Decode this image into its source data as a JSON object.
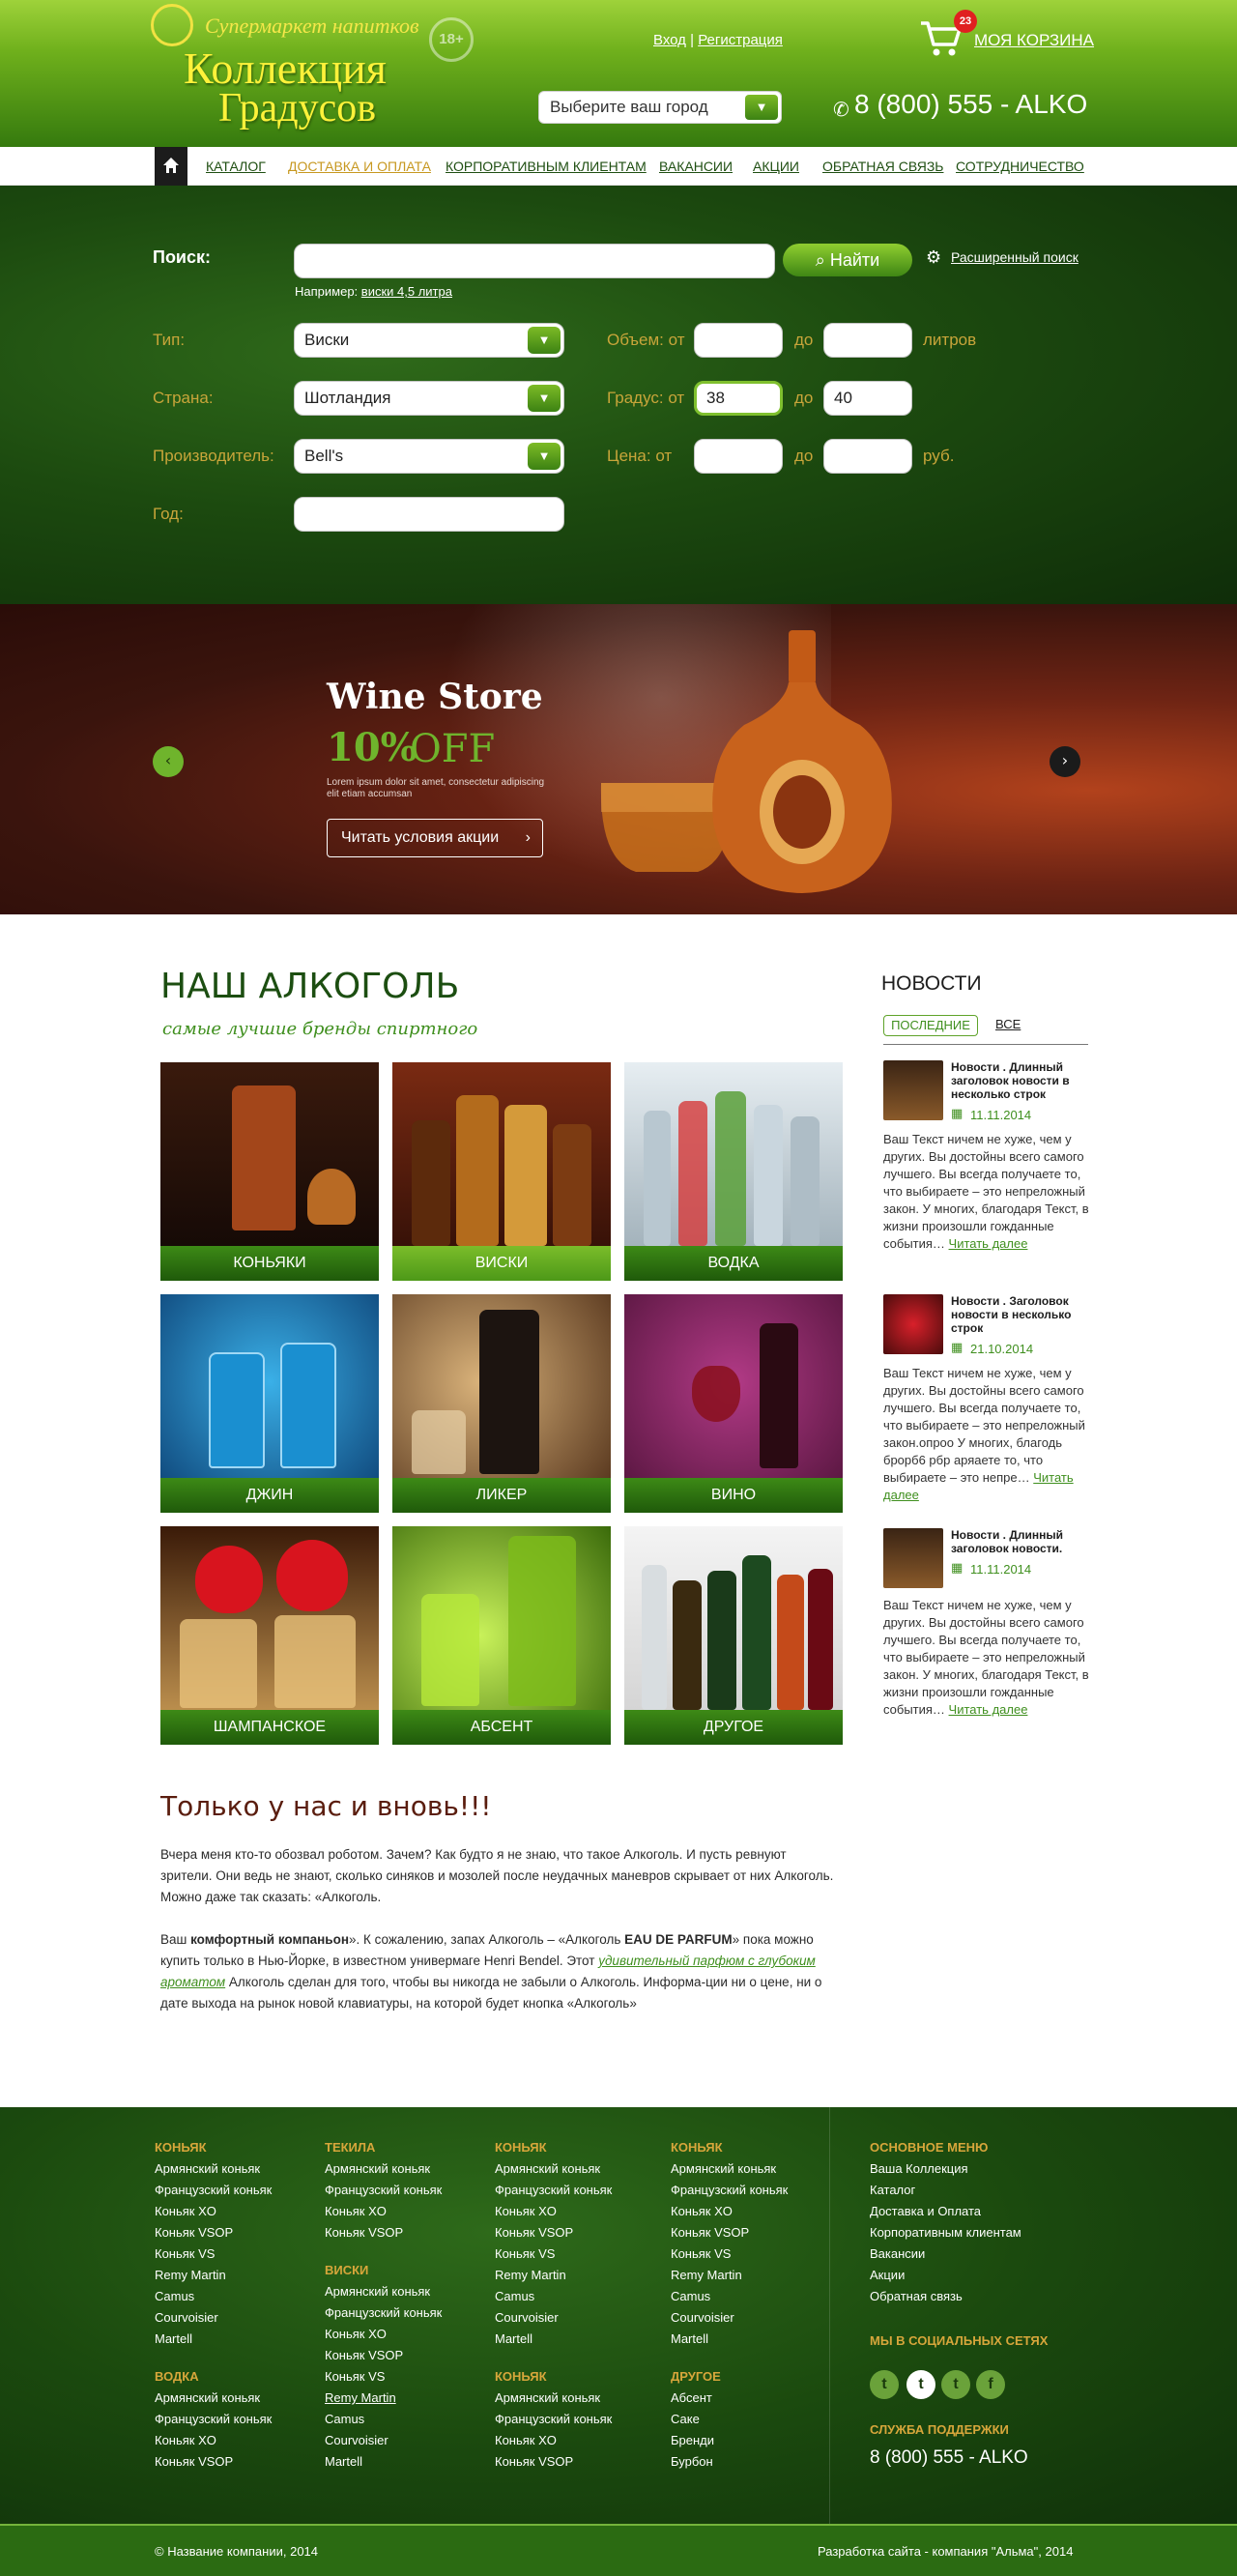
{
  "header": {
    "logo_tagline": "Супермаркет напитков",
    "logo_line1": "Коллекция",
    "logo_line2": "Градусов",
    "age_badge": "18+",
    "login": "Вход",
    "separator": "|",
    "register": "Регистрация",
    "cart_count": "23",
    "cart_label": "МОЯ КОРЗИНА",
    "city_select": "Выберите ваш город",
    "phone": "8 (800) 555 - ALKO"
  },
  "nav": {
    "items": [
      {
        "label": "КАТАЛОГ"
      },
      {
        "label": "ДОСТАВКА И ОПЛАТА",
        "active": true
      },
      {
        "label": "КОРПОРАТИВНЫМ КЛИЕНТАМ"
      },
      {
        "label": "ВАКАНСИИ"
      },
      {
        "label": "АКЦИИ"
      },
      {
        "label": "ОБРАТНАЯ СВЯЗЬ"
      },
      {
        "label": "СОТРУДНИЧЕСТВО"
      }
    ]
  },
  "search": {
    "label": "Поиск:",
    "value": "",
    "button": "Найти",
    "advanced": "Расширенный поиск",
    "example_prefix": "Например:",
    "example_link": "виски 4,5 литра",
    "type_label": "Тип:",
    "type_value": "Виски",
    "country_label": "Страна:",
    "country_value": "Шотландия",
    "maker_label": "Производитель:",
    "maker_value": "Bell's",
    "year_label": "Год:",
    "year_value": "",
    "volume_label": "Объем: от",
    "volume_from": "",
    "volume_to": "",
    "volume_unit": "литров",
    "degree_label": "Градус: от",
    "degree_from": "38",
    "degree_to": "40",
    "price_label": "Цена: от",
    "price_from": "",
    "price_to": "",
    "price_unit": "руб.",
    "to": "до"
  },
  "banner": {
    "title": "Wine Store",
    "percent": "10%",
    "off": "OFF",
    "lorem": "Lorem ipsum dolor sit amet, consectetur adipiscing elit etiam accumsan",
    "button": "Читать условия акции"
  },
  "catalog": {
    "title": "НАШ АЛКОГОЛЬ",
    "subtitle": "самые лучшие бренды спиртного",
    "tiles": [
      "КОНЬЯКИ",
      "ВИСКИ",
      "ВОДКА",
      "ДЖИН",
      "ЛИКЕР",
      "ВИНО",
      "ШАМПАНСКОЕ",
      "АБСЕНТ",
      "ДРУГОЕ"
    ]
  },
  "news": {
    "title": "НОВОСТИ",
    "tab_latest": "ПОСЛЕДНИЕ",
    "tab_all": "ВСЕ",
    "more": "Читать далее",
    "items": [
      {
        "title": "Новости . Длинный заголовок новости в несколько строк",
        "date": "11.11.2014",
        "text": "Ваш Текст ничем не хуже, чем у других. Вы достойны всего самого лучшего. Вы всегда получаете то, что выбираете – это непреложный закон. У многих, благодаря Текст, в жизни произошли гожданные события…"
      },
      {
        "title": "Новости . Заголовок новости в несколько строк",
        "date": "21.10.2014",
        "text": "Ваш Текст ничем не хуже, чем у других. Вы достойны всего самого лучшего. Вы всегда получаете то, что выбираете – это непреложный закон.опроо У многих, благодь брорб6 рбр аряаете то, что выбираете – это непре…"
      },
      {
        "title": "Новости . Длинный заголовок новости.",
        "date": "11.11.2014",
        "text": "Ваш Текст ничем не хуже, чем у других. Вы достойны всего самого лучшего. Вы всегда получаете то, что выбираете – это непреложный закон. У многих, благодаря Текст, в жизни произошли гожданные события…"
      }
    ]
  },
  "article": {
    "title": "Только у нас и вновь!!!",
    "p1": "Вчера меня кто-то обозвал роботом. Зачем? Как будто я не знаю, что такое Алкоголь. И пусть ревнуют зрители. Они ведь не знают, сколько синяков и мозолей после неудачных маневров скрывает от них Алкоголь. Можно даже так сказать: «Алкоголь.",
    "p2_a": "Ваш ",
    "p2_b": "комфортный компаньон",
    "p2_c": "». К сожалению, запах Алкоголь – «Алкоголь ",
    "p2_d": "EAU DE PARFUM",
    "p2_e": "» пока можно купить только в Нью-Йорке, в известном универмаге Henri Bendel. Этот ",
    "p2_link": "удивительный парфюм с глубоким ароматом",
    "p2_f": " Алкоголь сделан для того, чтобы вы никогда не забыли о Алкоголь. Информа-ции ни о цене, ни о дате выхода на рынок новой клавиатуры, на которой будет кнопка «Алкоголь»"
  },
  "footer": {
    "col1_head": "КОНЬЯК",
    "col1_links": [
      "Армянский коньяк",
      "Французский коньяк",
      "Коньяк XO",
      "Коньяк VSOP",
      "Коньяк VS",
      "Remy Martin",
      "Camus",
      "Courvoisier",
      "Martell"
    ],
    "col1b_head": "ВОДКА",
    "col1b_links": [
      "Армянский коньяк",
      "Французский коньяк",
      "Коньяк XO",
      "Коньяк VSOP"
    ],
    "col2_head": "ТЕКИЛА",
    "col2_links": [
      "Армянский коньяк",
      "Французский коньяк",
      "Коньяк XO",
      "Коньяк VSOP"
    ],
    "col2b_head": "ВИСКИ",
    "col2b_links": [
      "Армянский коньяк",
      "Французский коньяк",
      "Коньяк XO",
      "Коньяк VSOP",
      "Коньяк VS",
      "Remy Martin",
      "Camus",
      "Courvoisier",
      "Martell"
    ],
    "col3_head": "КОНЬЯК",
    "col3_links": [
      "Армянский коньяк",
      "Французский коньяк",
      "Коньяк XO",
      "Коньяк VSOP",
      "Коньяк VS",
      "Remy Martin",
      "Camus",
      "Courvoisier",
      "Martell"
    ],
    "col3b_head": "КОНЬЯК",
    "col3b_links": [
      "Армянский коньяк",
      "Французский коньяк",
      "Коньяк XO",
      "Коньяк VSOP"
    ],
    "col4_head": "КОНЬЯК",
    "col4_links": [
      "Армянский коньяк",
      "Французский коньяк",
      "Коньяк XO",
      "Коньяк VSOP",
      "Коньяк VS",
      "Remy Martin",
      "Camus",
      "Courvoisier",
      "Martell"
    ],
    "col4b_head": "ДРУГОЕ",
    "col4b_links": [
      "Абсент",
      "Саке",
      "Бренди",
      "Бурбон"
    ],
    "menu_head": "ОСНОВНОЕ МЕНЮ",
    "menu_links": [
      "Ваша Коллекция",
      "Каталог",
      "Доставка и Оплата",
      "Корпоративным клиентам",
      "Вакансии",
      "Акции",
      "Обратная связь"
    ],
    "social_head": "МЫ В СОЦИАЛЬНЫХ СЕТЯХ",
    "social": [
      "t",
      "t",
      "t",
      "f"
    ],
    "support_head": "СЛУЖБА ПОДДЕРЖКИ",
    "support_phone": "8 (800) 555 - ALKO",
    "copyright": "© Название компании, 2014",
    "developer": "Разработка сайта - компания \"Альма\", 2014"
  }
}
